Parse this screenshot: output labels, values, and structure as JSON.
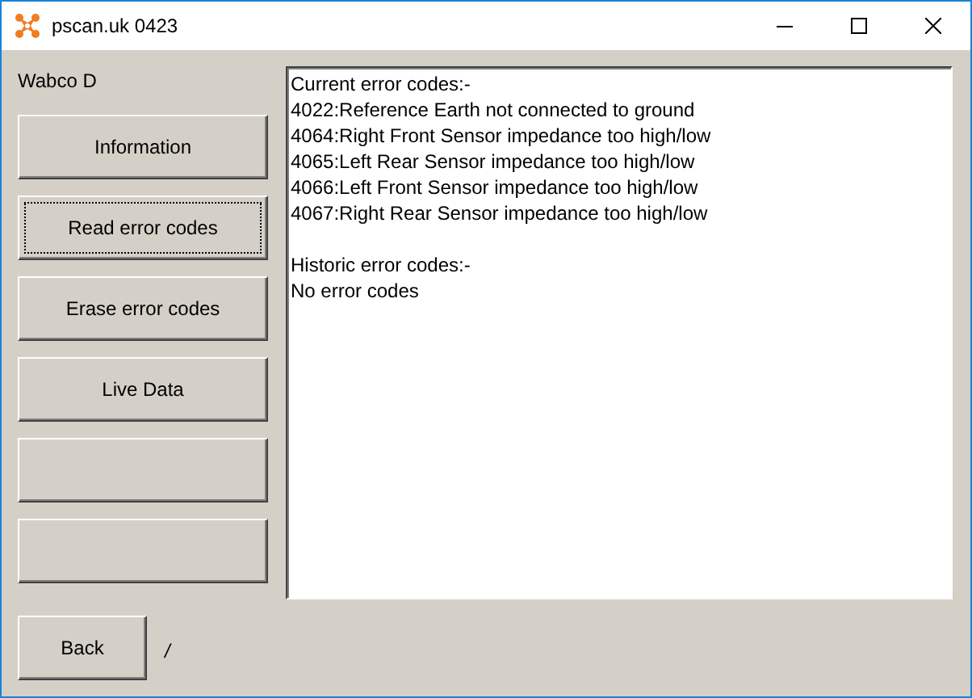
{
  "window": {
    "title": "pscan.uk 0423"
  },
  "device_label": "Wabco D",
  "buttons": [
    {
      "kind": "labeled",
      "label": "Information",
      "focused": false
    },
    {
      "kind": "labeled",
      "label": "Read error codes",
      "focused": true
    },
    {
      "kind": "labeled",
      "label": "Erase error codes",
      "focused": false
    },
    {
      "kind": "labeled",
      "label": "Live Data",
      "focused": false
    },
    {
      "kind": "blank",
      "focused": false
    },
    {
      "kind": "blank",
      "focused": false
    }
  ],
  "output": {
    "sections": [
      {
        "heading": "Current error codes:-",
        "lines": [
          "4022:Reference Earth not connected to ground",
          "4064:Right Front Sensor impedance too high/low",
          "4065:Left Rear Sensor impedance too high/low",
          "4066:Left Front Sensor impedance too high/low",
          "4067:Right Rear Sensor impedance too high/low"
        ]
      },
      {
        "heading": "Historic error codes:-",
        "lines": [
          "No error codes"
        ]
      }
    ]
  },
  "back_button": {
    "label": "Back"
  },
  "status_text": "/"
}
